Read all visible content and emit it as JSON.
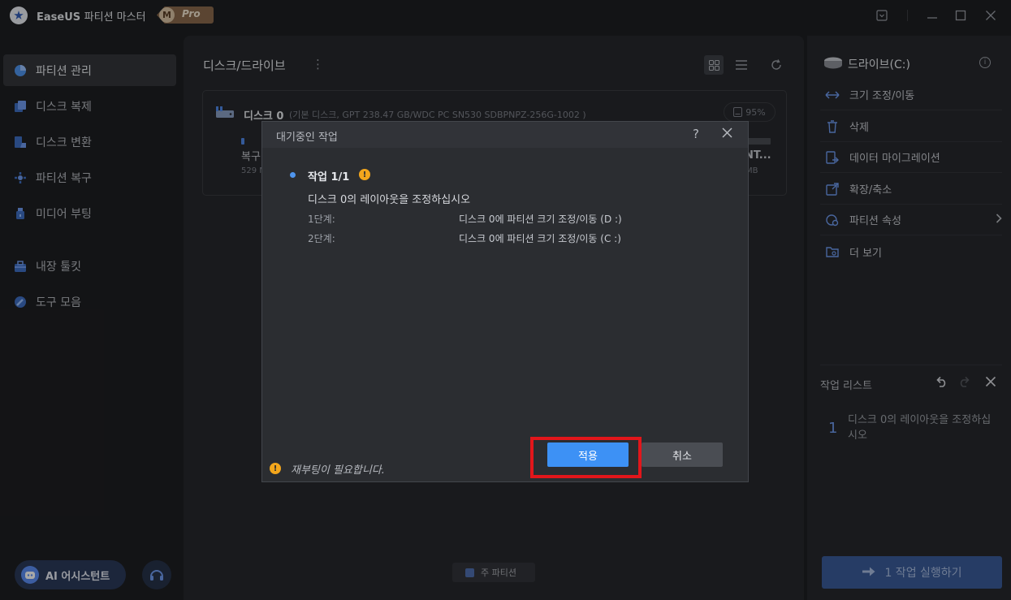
{
  "titlebar": {
    "brand": "EaseUS",
    "product": "파티션 마스터",
    "badge_letter": "M",
    "badge_text": "Pro"
  },
  "sidebar": {
    "items": [
      {
        "label": "파티션 관리",
        "icon": "pie-chart-icon",
        "active": true
      },
      {
        "label": "디스크 복제",
        "icon": "copy-icon"
      },
      {
        "label": "디스크 변환",
        "icon": "convert-icon"
      },
      {
        "label": "파티션 복구",
        "icon": "recovery-icon"
      },
      {
        "label": "미디어 부팅",
        "icon": "usb-icon"
      },
      {
        "label": "내장 툴킷",
        "icon": "toolkit-icon"
      },
      {
        "label": "도구 모음",
        "icon": "tools-icon"
      }
    ],
    "ai_button": "AI 어시스턴트"
  },
  "main": {
    "title": "디스크/드라이브",
    "disk": {
      "name": "디스크 0",
      "meta": "(기본 디스크, GPT 238.47 GB/WDC PC SN530 SDBPNPZ-256G-1002 )",
      "usage": "95%",
      "left_partition_label": "복구",
      "left_partition_size": "529 M",
      "right_partition_label": "NT...",
      "right_partition_size": "MB"
    },
    "legend": "주 파티션"
  },
  "right": {
    "drive": "드라이브(C:)",
    "actions": [
      {
        "label": "크기 조정/이동",
        "icon": "resize-icon"
      },
      {
        "label": "삭제",
        "icon": "trash-icon"
      },
      {
        "label": "데이터 마이그레이션",
        "icon": "migrate-icon"
      },
      {
        "label": "확장/축소",
        "icon": "extend-icon"
      },
      {
        "label": "파티션 속성",
        "icon": "properties-icon",
        "chevron": true
      },
      {
        "label": "더 보기",
        "icon": "more-folder-icon"
      }
    ],
    "ops_title": "작업 리스트",
    "op_number": "1",
    "op_text": "디스크 0의 레이아웃을 조정하십시오",
    "run_button": "1 작업 실행하기"
  },
  "dialog": {
    "title": "대기중인 작업",
    "task_title": "작업 1/1",
    "task_desc": "디스크 0의 레이아웃을 조정하십시오",
    "steps": [
      {
        "label": "1단계:",
        "value": "디스크 0에 파티션 크기 조정/이동 (D :)"
      },
      {
        "label": "2단계:",
        "value": "디스크 0에 파티션 크기 조정/이동 (C :)"
      }
    ],
    "reboot_note": "재부팅이 필요합니다.",
    "apply": "적용",
    "cancel": "취소"
  },
  "colors": {
    "accent": "#3d91f5",
    "highlight": "#e2161b",
    "warning": "#f3a61c"
  }
}
